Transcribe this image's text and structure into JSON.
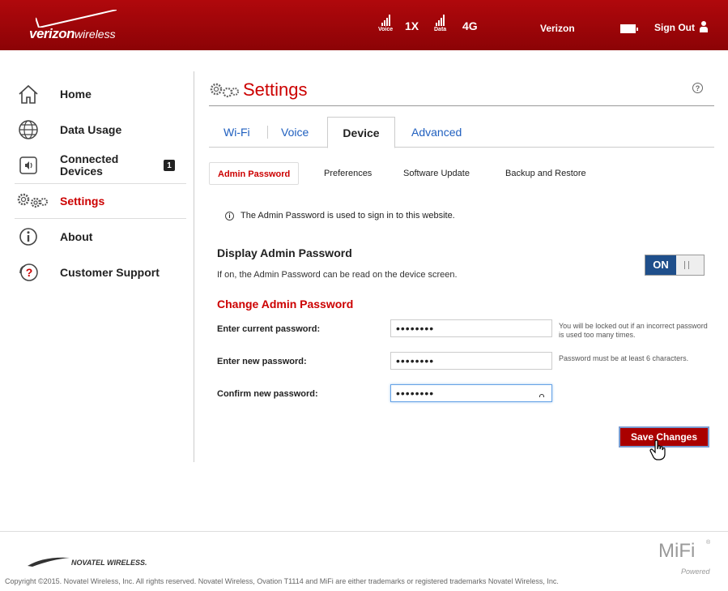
{
  "header": {
    "brand_bold": "verizon",
    "brand_light": "wireless",
    "signal_voice_label": "Voice",
    "signal_voice_tech": "1X",
    "signal_data_label": "Data",
    "signal_data_tech": "4G",
    "carrier": "Verizon",
    "sign_out": "Sign Out"
  },
  "sidebar": {
    "items": [
      {
        "label": "Home",
        "icon": "home-icon"
      },
      {
        "label": "Data Usage",
        "icon": "globe-icon"
      },
      {
        "label": "Connected Devices",
        "icon": "speaker-icon",
        "badge": "1"
      },
      {
        "label": "Settings",
        "icon": "gears-icon",
        "active": true
      },
      {
        "label": "About",
        "icon": "info-icon"
      },
      {
        "label": "Customer Support",
        "icon": "support-icon"
      }
    ]
  },
  "main": {
    "title": "Settings",
    "help": "?",
    "tabs": [
      {
        "label": "Wi-Fi"
      },
      {
        "label": "Voice"
      },
      {
        "label": "Device",
        "active": true
      },
      {
        "label": "Advanced"
      }
    ],
    "subtabs": [
      {
        "label": "Admin Password",
        "active": true
      },
      {
        "label": "Preferences"
      },
      {
        "label": "Software Update"
      },
      {
        "label": "Backup and Restore"
      }
    ],
    "info": "The Admin Password is used to sign in to this website.",
    "display_section": {
      "title": "Display Admin Password",
      "desc": "If on, the Admin Password can be read on the device screen.",
      "toggle": "ON"
    },
    "change_section": {
      "title": "Change Admin Password",
      "fields": [
        {
          "label": "Enter current password:",
          "value": "••••••••",
          "hint": "You will be locked out if an incorrect password is used too many times."
        },
        {
          "label": "Enter new password:",
          "value": "••••••••",
          "hint": "Password must be at least 6 characters."
        },
        {
          "label": "Confirm new password:",
          "value": "••••••••",
          "hint": ""
        }
      ]
    },
    "save_label": "Save Changes"
  },
  "footer": {
    "novatel": "NOVATEL WIRELESS.",
    "mifi": "MiFi",
    "mifi_reg": "®",
    "mifi_powered": "Powered",
    "copyright": "Copyright ©2015. Novatel Wireless, Inc. All rights reserved. Novatel Wireless, Ovation T1114 and MiFi are either trademarks or registered trademarks Novatel Wireless, Inc."
  },
  "colors": {
    "brand_red": "#b0080c",
    "accent_red": "#cc0000",
    "link_blue": "#1f5fbf",
    "toggle_blue": "#1f4f8b"
  }
}
